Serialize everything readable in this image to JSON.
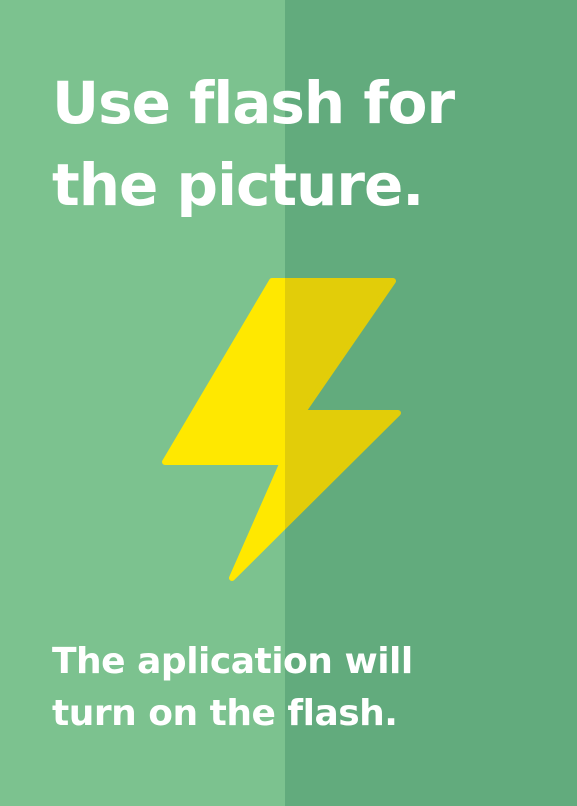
{
  "colors": {
    "panel_left": "#7cc28f",
    "panel_right": "#62ab7d",
    "bolt_light": "#ffe800",
    "bolt_shade": "#e2cd09",
    "text": "#ffffff"
  },
  "headline": {
    "line1": "Use flash for",
    "line2": "the picture."
  },
  "subtext": {
    "line1": "The aplication will",
    "line2": "turn on the flash."
  },
  "icon": "lightning-bolt-icon"
}
